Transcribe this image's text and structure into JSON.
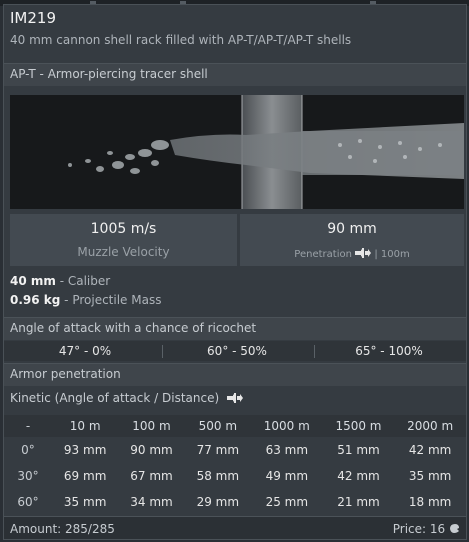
{
  "header": {
    "title": "IM219",
    "subtitle": "40 mm cannon shell rack filled with AP-T/AP-T/AP-T shells"
  },
  "shell": {
    "type_label": "AP-T - Armor-piercing tracer shell"
  },
  "stats": {
    "velocity_value": "1005 m/s",
    "velocity_label": "Muzzle Velocity",
    "penetration_value": "90 mm",
    "penetration_label": "Penetration",
    "penetration_distance": "| 100m"
  },
  "specs": {
    "caliber_value": "40 mm",
    "caliber_label": " - Caliber",
    "mass_value": "0.96 kg",
    "mass_label": " - Projectile Mass"
  },
  "ricochet": {
    "title": "Angle of attack with a chance of ricochet",
    "items": [
      "47° - 0%",
      "60° - 50%",
      "65° - 100%"
    ]
  },
  "armor": {
    "title": "Armor penetration",
    "kinetic_label": "Kinetic (Angle of attack / Distance)",
    "columns": [
      "-",
      "10 m",
      "100 m",
      "500 m",
      "1000 m",
      "1500 m",
      "2000 m"
    ],
    "rows": [
      [
        "0°",
        "93 mm",
        "90 mm",
        "77 mm",
        "63 mm",
        "51 mm",
        "42 mm"
      ],
      [
        "30°",
        "69 mm",
        "67 mm",
        "58 mm",
        "49 mm",
        "42 mm",
        "35 mm"
      ],
      [
        "60°",
        "35 mm",
        "34 mm",
        "29 mm",
        "25 mm",
        "21 mm",
        "18 mm"
      ]
    ]
  },
  "footer": {
    "amount": "Amount: 285/285",
    "price": "Price: 16"
  },
  "icons": {
    "penetration": "shell-penetration-icon",
    "currency": "silver-lion-icon"
  },
  "colors": {
    "panel": "#353b41",
    "section_bar": "#3f454b",
    "stat_box": "#434a51"
  }
}
